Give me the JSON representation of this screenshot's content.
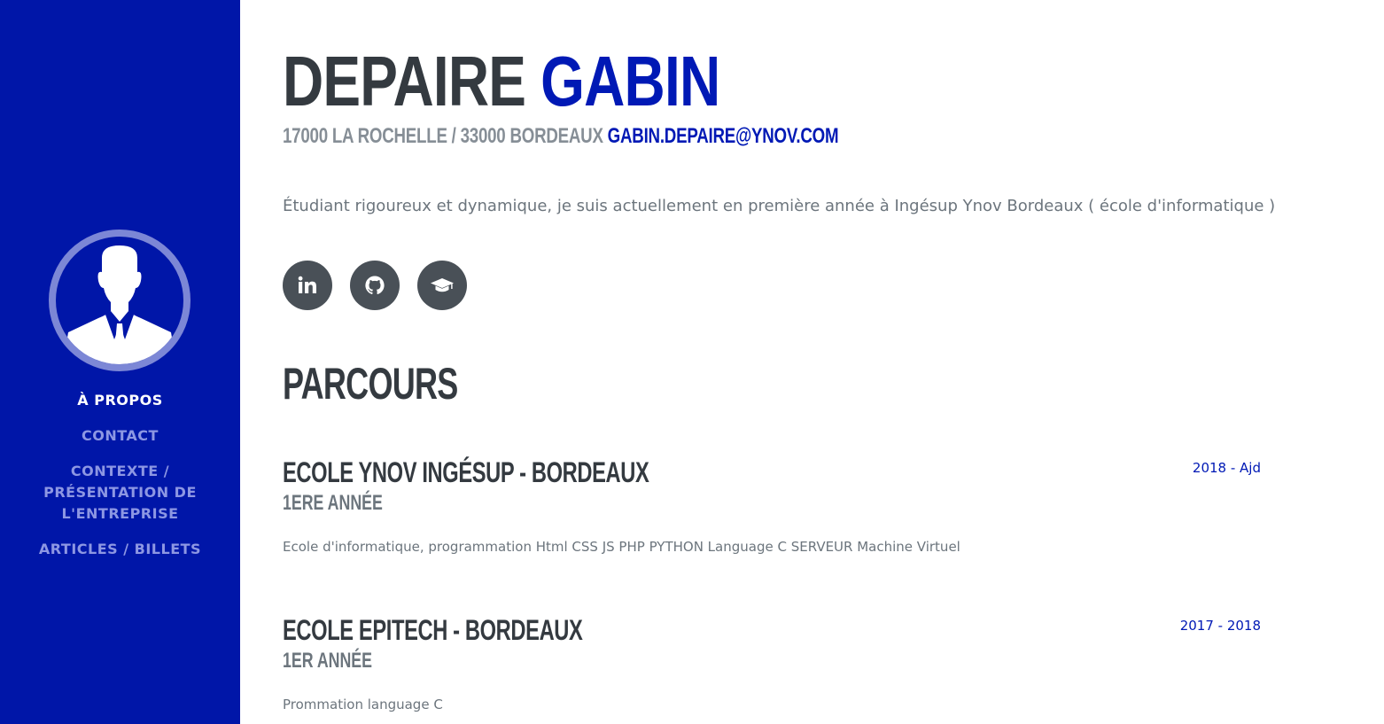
{
  "sidebar": {
    "avatar_label": "profile-avatar",
    "nav": [
      {
        "label": "À propos",
        "active": true
      },
      {
        "label": "Contact",
        "active": false
      },
      {
        "label": "Contexte / Présentation de l'entreprise",
        "active": false
      },
      {
        "label": "Articles / Billets",
        "active": false
      }
    ]
  },
  "about": {
    "last_name": "Depaire",
    "first_name": "Gabin",
    "location": "17000 La Rochelle / 33000 Bordeaux",
    "email": "gabin.depaire@ynov.com",
    "intro": "Étudiant rigoureux et dynamique, je suis actuellement en première année à Ingésup Ynov Bordeaux ( école d'informatique )",
    "social": [
      {
        "icon": "linkedin-icon"
      },
      {
        "icon": "github-icon"
      },
      {
        "icon": "graduation-cap-icon"
      }
    ]
  },
  "parcours": {
    "title": "Parcours",
    "items": [
      {
        "title": "Ecole Ynov Ingésup - Bordeaux",
        "subtitle": "1ere année",
        "description": "Ecole d'informatique, programmation Html CSS JS PHP PYTHON Language C SERVEUR Machine Virtuel",
        "date": "2018 - Ajd"
      },
      {
        "title": "Ecole Epitech - Bordeaux",
        "subtitle": "1er année",
        "description": "Prommation language C",
        "date": "2017 - 2018"
      }
    ]
  },
  "colors": {
    "primary": "#0016a8",
    "accent": "#0019b5",
    "dark": "#343a40",
    "muted": "#6c757d"
  }
}
